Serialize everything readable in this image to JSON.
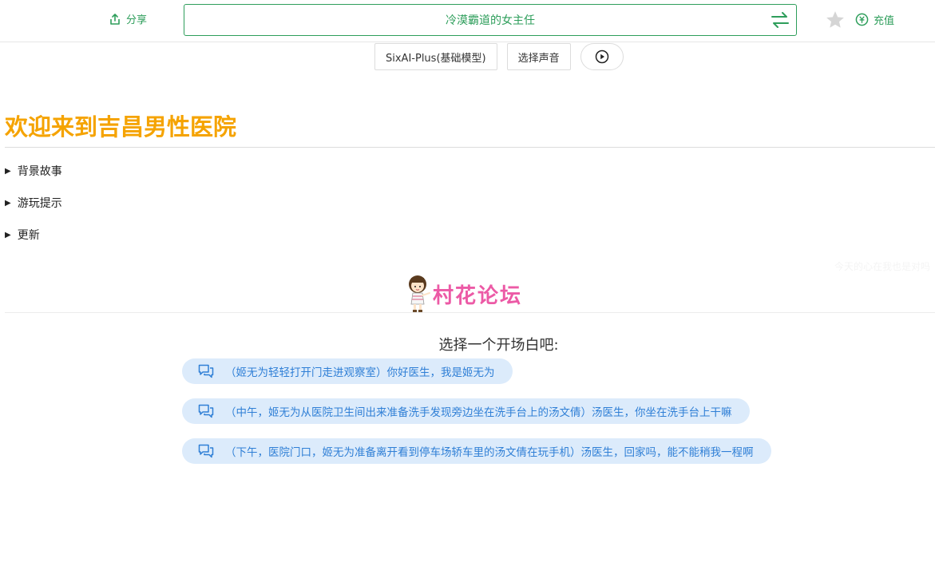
{
  "header": {
    "share_label": "分享",
    "title": "冷漠霸道的女主任",
    "recharge_label": "充值",
    "brand_color": "#2e9e5b"
  },
  "controls": {
    "model_label": "SixAI-Plus(基础模型)",
    "voice_label": "选择声音"
  },
  "content": {
    "welcome": "欢迎来到吉昌男性医院",
    "sections": [
      "背景故事",
      "游玩提示",
      "更新"
    ],
    "faint_text": "今天的心在我也是对吗",
    "logo_text": "村花论坛",
    "openers_title": "选择一个开场白吧:",
    "openers": [
      "（姬无为轻轻打开门走进观察室）你好医生，我是姬无为",
      "（中午，姬无为从医院卫生间出来准备洗手发现旁边坐在洗手台上的汤文倩）汤医生，你坐在洗手台上干嘛",
      "（下午，医院门口，姬无为准备离开看到停车场轿车里的汤文倩在玩手机）汤医生，回家吗，能不能稍我一程啊"
    ]
  }
}
